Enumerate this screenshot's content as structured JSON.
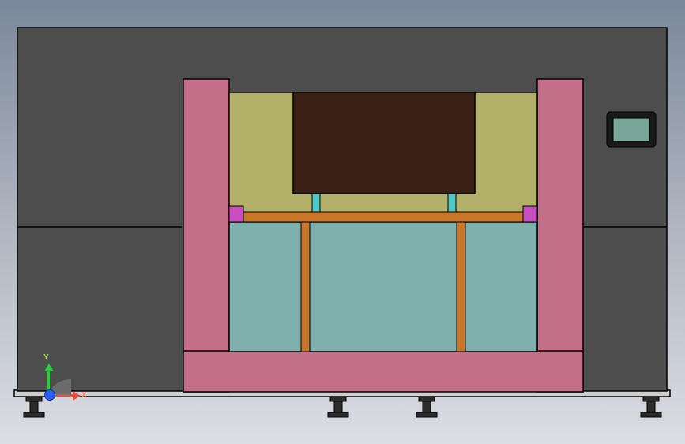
{
  "triad": {
    "x_label": "X",
    "y_label": "Y",
    "z_label": ""
  },
  "colors": {
    "outline": "#000000",
    "dark_gray": "#4d4d4d",
    "pink": "#c56f8b",
    "olive": "#b3b06a",
    "teal_panel": "#7fb0ad",
    "brown_dark": "#3a1f14",
    "orange": "#c9752a",
    "cyan": "#4fc7c7",
    "magenta": "#c84fc0",
    "screen_frame": "#1a1a1a",
    "screen_face": "#7aa69a",
    "foot_dark": "#2b2b2b",
    "silver": "#bfbfbf",
    "bg_top": "#7b889b",
    "bg_bot": "#dbdee3"
  },
  "model_view": {
    "projection": "orthographic_front",
    "description": "CAD front view of an industrial cabinet/machine enclosure with central U-shaped pink frame, olive upper cavity containing dark brown box, teal lower window with orange mullions, small touchscreen on right side, and four leveling feet.",
    "parts": [
      "enclosure-left-panel",
      "enclosure-right-panel",
      "enclosure-base-strip",
      "pink-u-frame",
      "olive-cavity",
      "brown-insert",
      "cyan-support-left",
      "cyan-support-right",
      "magenta-bracket-left",
      "magenta-bracket-right",
      "orange-crossbar",
      "orange-divider-left",
      "orange-divider-right",
      "teal-lower-window",
      "touchscreen",
      "foot-1",
      "foot-2",
      "foot-3",
      "foot-4"
    ]
  }
}
